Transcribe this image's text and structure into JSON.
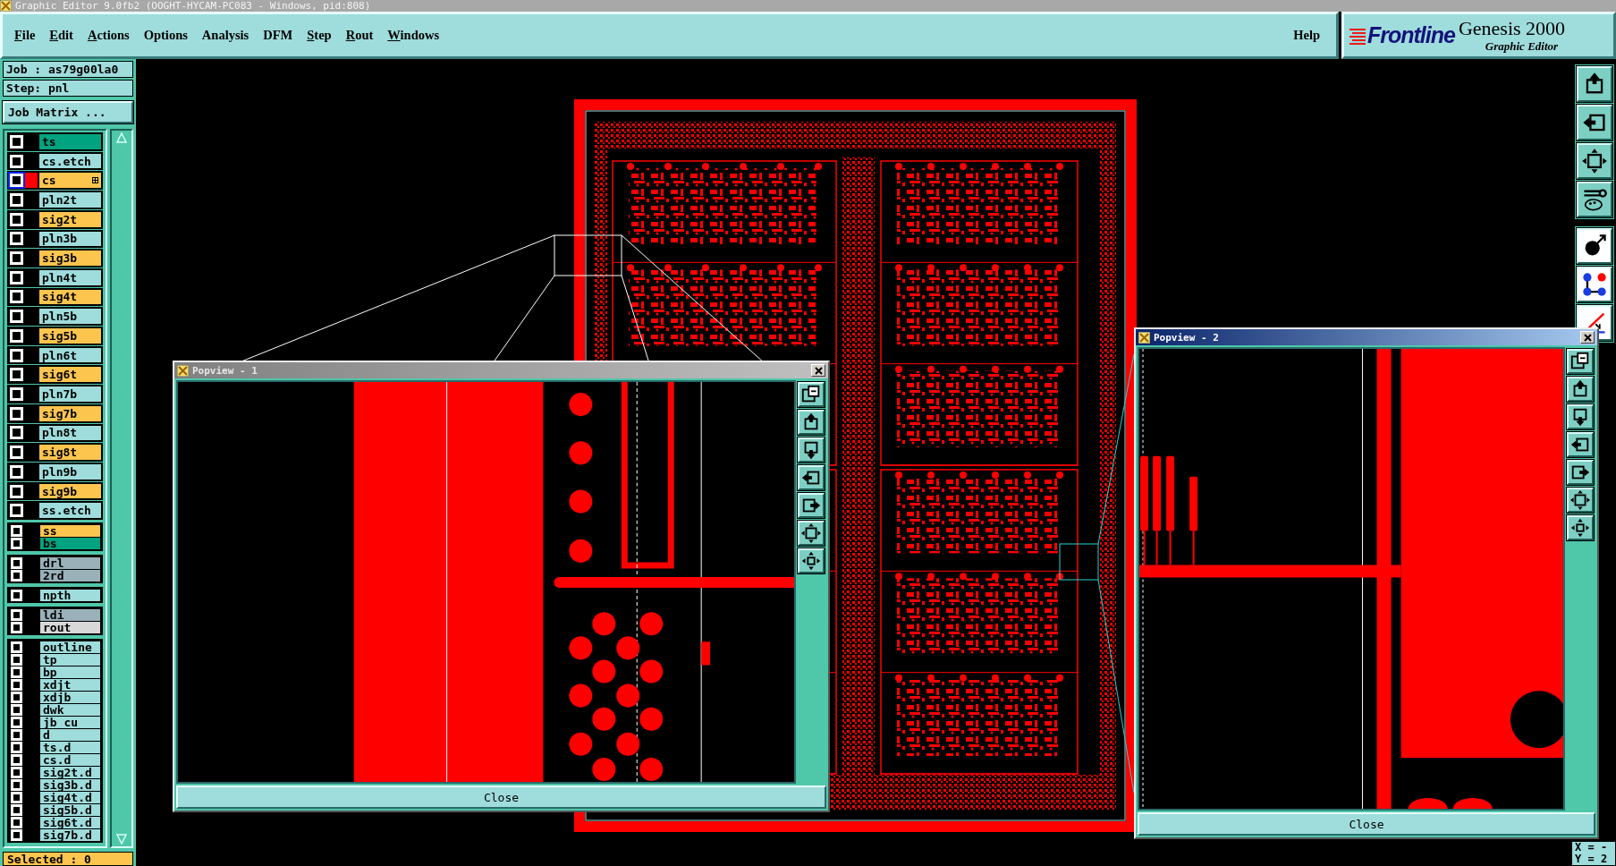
{
  "window": {
    "title": "Graphic Editor 9.0fb2 (OOGHT-HYCAM-PC083 - Windows, pid:808)"
  },
  "menu": [
    {
      "label": "File",
      "underlined": true
    },
    {
      "label": "Edit",
      "underlined": true
    },
    {
      "label": "Actions",
      "underlined": true
    },
    {
      "label": "Options",
      "underlined": false
    },
    {
      "label": "Analysis",
      "underlined": false
    },
    {
      "label": "DFM",
      "underlined": false
    },
    {
      "label": "Step",
      "underlined": true
    },
    {
      "label": "Rout",
      "underlined": true
    },
    {
      "label": "Windows",
      "underlined": true
    }
  ],
  "help": "Help",
  "logo": {
    "brand": "Frontline",
    "product": "Genesis 2000",
    "subtitle": "Graphic Editor"
  },
  "job": "Job : as79g00la0",
  "step": "Step: pnl",
  "job_matrix_button": "Job Matrix ...",
  "layer_groups": [
    {
      "layers": [
        {
          "name": "ts",
          "color": "#00a37f",
          "selected": false
        },
        {
          "name": "cs.etch",
          "color": "#9fdcdc",
          "selected": false
        },
        {
          "name": "cs",
          "color": "#fcc54e",
          "selected": true
        },
        {
          "name": "pln2t",
          "color": "#9fdcdc",
          "selected": false
        },
        {
          "name": "sig2t",
          "color": "#fcc54e",
          "selected": false
        },
        {
          "name": "pln3b",
          "color": "#9fdcdc",
          "selected": false
        },
        {
          "name": "sig3b",
          "color": "#fcc54e",
          "selected": false
        },
        {
          "name": "pln4t",
          "color": "#9fdcdc",
          "selected": false
        },
        {
          "name": "sig4t",
          "color": "#fcc54e",
          "selected": false
        },
        {
          "name": "pln5b",
          "color": "#9fdcdc",
          "selected": false
        },
        {
          "name": "sig5b",
          "color": "#fcc54e",
          "selected": false
        },
        {
          "name": "pln6t",
          "color": "#9fdcdc",
          "selected": false
        },
        {
          "name": "sig6t",
          "color": "#fcc54e",
          "selected": false
        },
        {
          "name": "pln7b",
          "color": "#9fdcdc",
          "selected": false
        },
        {
          "name": "sig7b",
          "color": "#fcc54e",
          "selected": false
        },
        {
          "name": "pln8t",
          "color": "#9fdcdc",
          "selected": false
        },
        {
          "name": "sig8t",
          "color": "#fcc54e",
          "selected": false
        },
        {
          "name": "pln9b",
          "color": "#9fdcdc",
          "selected": false
        },
        {
          "name": "sig9b",
          "color": "#fcc54e",
          "selected": false
        },
        {
          "name": "ss.etch",
          "color": "#9fdcdc",
          "selected": false
        }
      ]
    },
    {
      "layers": [
        {
          "name": "ss",
          "color": "#fcc54e",
          "selected": false
        },
        {
          "name": "bs",
          "color": "#00a37f",
          "selected": false
        }
      ]
    },
    {
      "layers": [
        {
          "name": "drl",
          "color": "#9ab1b9",
          "selected": false
        },
        {
          "name": "2rd",
          "color": "#9ab1b9",
          "selected": false
        }
      ]
    },
    {
      "layers": [
        {
          "name": "npth",
          "color": "#9fdcdc",
          "selected": false
        }
      ]
    },
    {
      "layers": [
        {
          "name": "ldi",
          "color": "#9ab1b9",
          "selected": false
        },
        {
          "name": "rout",
          "color": "#d8d8d8",
          "selected": false
        }
      ]
    },
    {
      "layers": [
        {
          "name": "outline",
          "color": "#9fdcdc",
          "selected": false
        },
        {
          "name": "tp",
          "color": "#9fdcdc",
          "selected": false
        },
        {
          "name": "bp",
          "color": "#9fdcdc",
          "selected": false
        },
        {
          "name": "xdjt",
          "color": "#9fdcdc",
          "selected": false
        },
        {
          "name": "xdjb",
          "color": "#9fdcdc",
          "selected": false
        },
        {
          "name": "dwk",
          "color": "#9fdcdc",
          "selected": false
        },
        {
          "name": "jb_cu",
          "color": "#9fdcdc",
          "selected": false
        },
        {
          "name": "d",
          "color": "#9fdcdc",
          "selected": false
        },
        {
          "name": "ts.d",
          "color": "#9fdcdc",
          "selected": false
        },
        {
          "name": "cs.d",
          "color": "#9fdcdc",
          "selected": false
        },
        {
          "name": "sig2t.d",
          "color": "#9fdcdc",
          "selected": false
        },
        {
          "name": "sig3b.d",
          "color": "#9fdcdc",
          "selected": false
        },
        {
          "name": "sig4t.d",
          "color": "#9fdcdc",
          "selected": false
        },
        {
          "name": "sig5b.d",
          "color": "#9fdcdc",
          "selected": false
        },
        {
          "name": "sig6t.d",
          "color": "#9fdcdc",
          "selected": false
        },
        {
          "name": "sig7b.d",
          "color": "#9fdcdc",
          "selected": false
        }
      ]
    }
  ],
  "selected_count": "Selected : 0",
  "popviews": [
    {
      "title": "Popview - 1",
      "active": false,
      "close_label": "Close"
    },
    {
      "title": "Popview - 2",
      "active": true,
      "close_label": "Close"
    }
  ],
  "coordinates": [
    "X = -",
    "Y = 2"
  ]
}
